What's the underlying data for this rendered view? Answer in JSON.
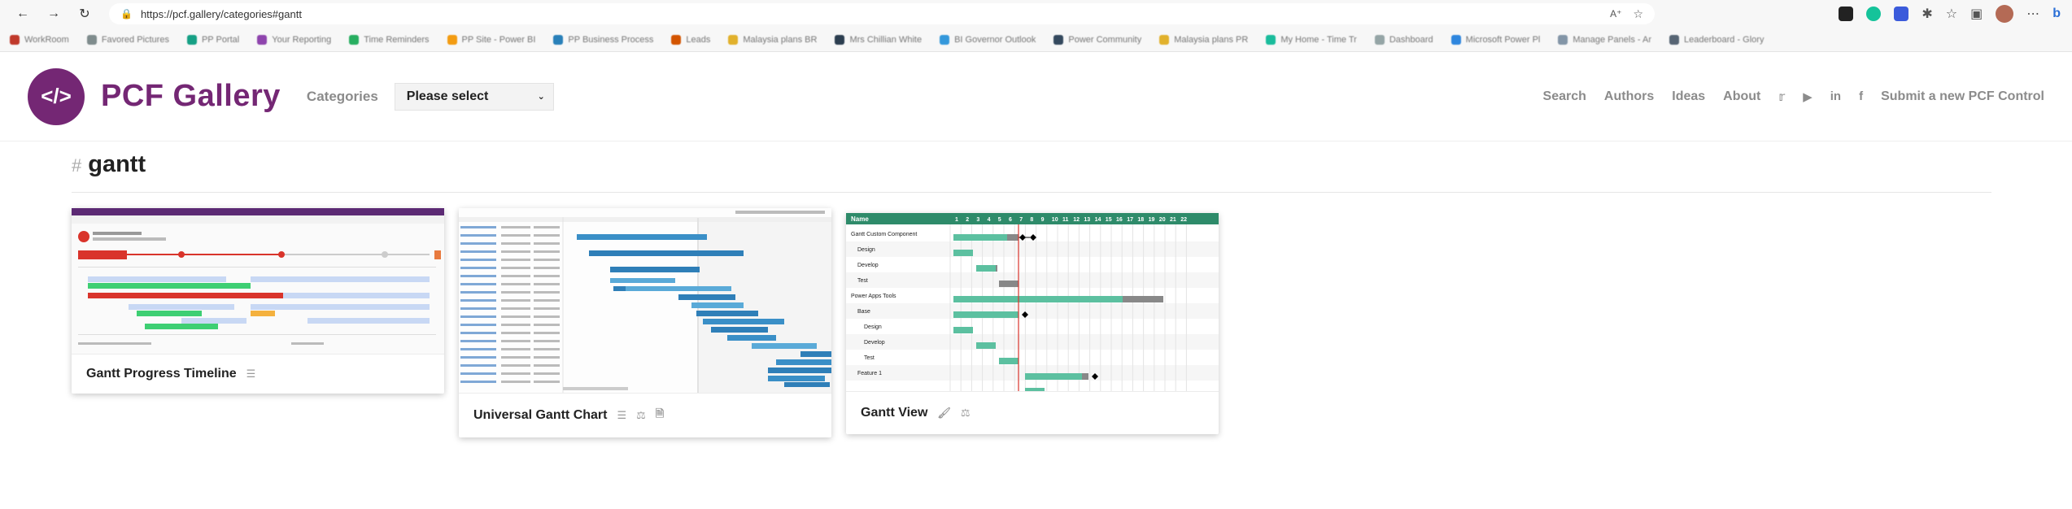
{
  "browser": {
    "url": "https://pcf.gallery/categories#gantt",
    "bookmarks": [
      "WorkRoom",
      "Favored Pictures",
      "PP Portal",
      "Your Reporting",
      "Time Reminders",
      "PP Site - Power BI",
      "PP Business Process",
      "Leads",
      "Malaysia plans BR",
      "Mrs Chillian White",
      "BI Governor Outlook",
      "Power Community",
      "Malaysia plans PR",
      "My Home - Time Tr",
      "Dashboard",
      "Microsoft Power Pl",
      "Manage Panels - Ar",
      "Leaderboard - Glory"
    ]
  },
  "site": {
    "logo_text": "PCF Gallery",
    "nav": {
      "categories_label": "Categories",
      "select_value": "Please select",
      "search": "Search",
      "authors": "Authors",
      "ideas": "Ideas",
      "about": "About",
      "submit": "Submit a new PCF Control"
    }
  },
  "page": {
    "hash": "#",
    "heading": "gantt"
  },
  "cards": [
    {
      "title": "Gantt Progress Timeline",
      "icons": [
        "list-icon"
      ]
    },
    {
      "title": "Universal Gantt Chart",
      "icons": [
        "list-icon",
        "balance-icon",
        "document-icon"
      ]
    },
    {
      "title": "Gantt View",
      "icons": [
        "brush-icon",
        "balance-icon"
      ]
    }
  ],
  "gantt_view_preview": {
    "header_name": "Name",
    "days": [
      "1",
      "2",
      "3",
      "4",
      "5",
      "6",
      "7",
      "8",
      "9",
      "10",
      "11",
      "12",
      "13",
      "14",
      "15",
      "16",
      "17",
      "18",
      "19",
      "20",
      "21",
      "22"
    ],
    "rows": [
      "Gantt Custom Component",
      "Design",
      "Develop",
      "Test",
      "Power Apps Tools",
      "Base",
      "Design",
      "Develop",
      "Test",
      "Feature 1"
    ]
  },
  "colors": {
    "brand": "#742774",
    "gantt_green": "#2e8b6a",
    "bar_teal": "#5cc0a0",
    "bar_gray": "#888888",
    "bar_blue": "#3a8fc7"
  }
}
